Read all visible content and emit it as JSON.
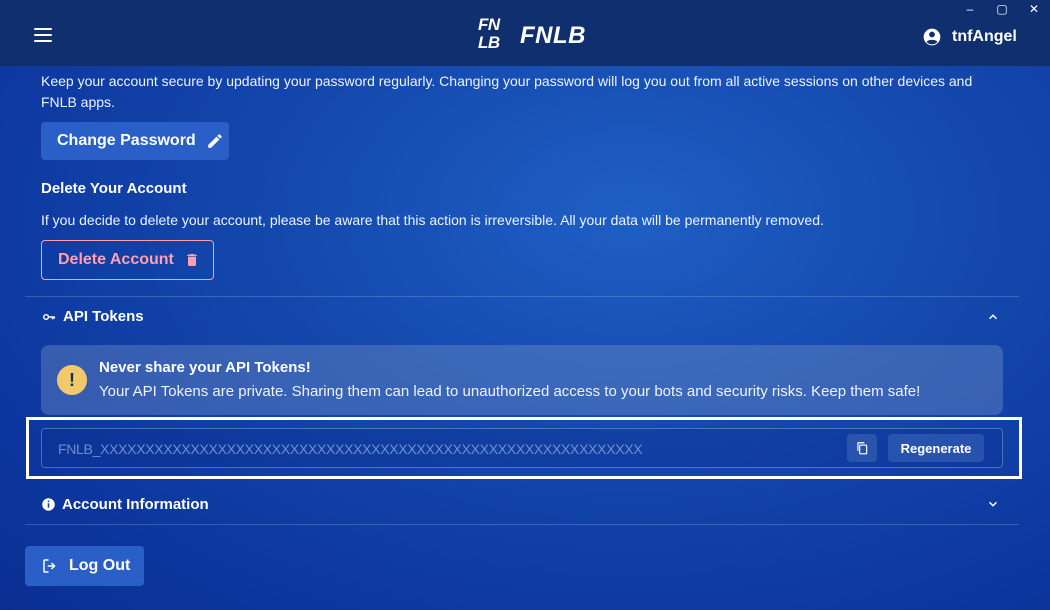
{
  "window": {
    "controls": {
      "minimize": "–",
      "maximize": "▢",
      "close": "✕"
    }
  },
  "header": {
    "logo_line1": "FN",
    "logo_line2": "LB",
    "brand": "FNLB",
    "username": "tnfAngel"
  },
  "security": {
    "password_description": "Keep your account secure by updating your password regularly. Changing your password will log you out from all active sessions on other devices and FNLB apps.",
    "change_password_label": "Change Password",
    "delete_heading": "Delete Your Account",
    "delete_description": "If you decide to delete your account, please be aware that this action is irreversible. All your data will be permanently removed.",
    "delete_label": "Delete Account"
  },
  "api_tokens": {
    "heading": "API Tokens",
    "alert_title": "Never share your API Tokens!",
    "alert_body": "Your API Tokens are private. Sharing them can lead to unauthorized access to your bots and security risks. Keep them safe!",
    "token_value": "FNLB_XXXXXXXXXXXXXXXXXXXXXXXXXXXXXXXXXXXXXXXXXXXXXXXXXXXXXXXXXXXX",
    "regenerate_label": "Regenerate"
  },
  "account_info": {
    "heading": "Account Information"
  },
  "logout_label": "Log Out",
  "colors": {
    "header_bg": "#0f2f6e",
    "primary_button": "#2a5fc7",
    "danger": "#ff9fb0",
    "warning": "#f2c96a"
  }
}
